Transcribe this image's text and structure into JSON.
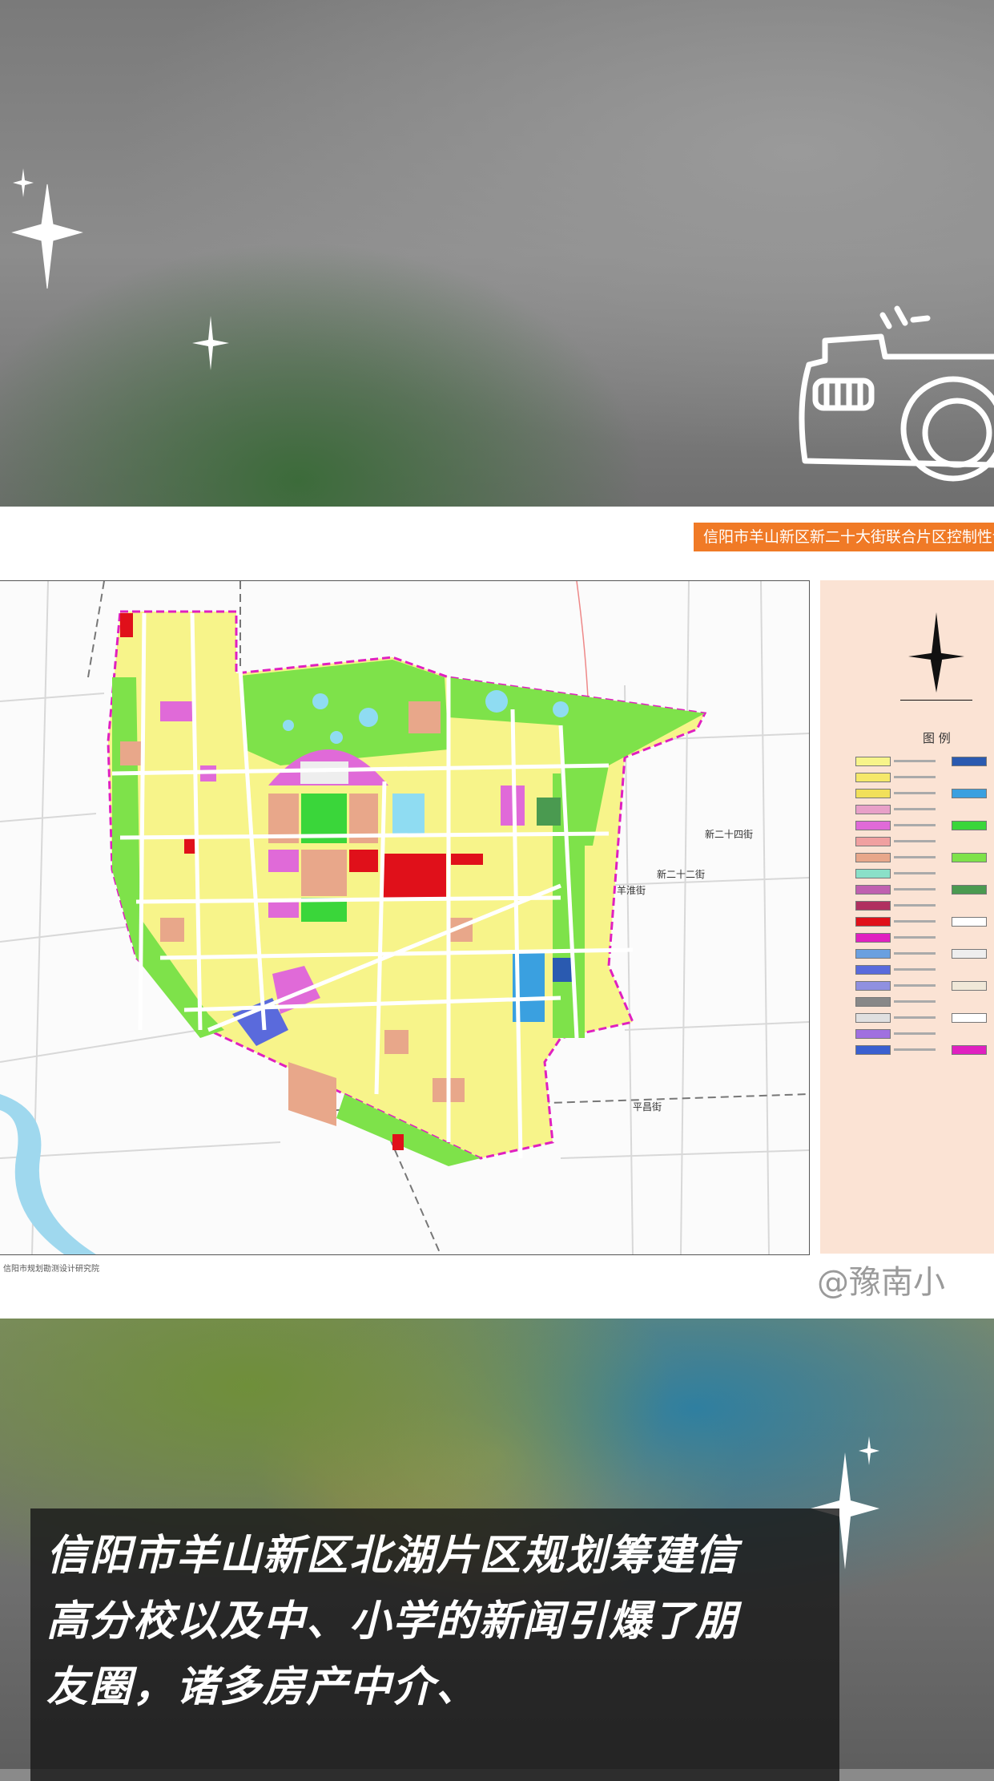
{
  "map": {
    "header_title": "信阳市羊山新区新二十大街联合片区控制性详细规划",
    "legend_title": "图 例",
    "street_labels": [
      "羊淮街",
      "新二十二街",
      "新二十四街",
      "平昌街"
    ],
    "institute": "信阳市规划勘测设计研究院",
    "watermark": "@豫南小"
  },
  "caption": {
    "text": "信阳市羊山新区北湖片区规划筹建信高分校以及中、小学的新闻引爆了朋友圈，诸多房产中介、"
  },
  "icons": [
    "sparkle-icon",
    "camera-icon",
    "north-arrow-icon"
  ],
  "colors": {
    "header": "#f07a26",
    "residential": "#f7f48a",
    "green": "#7ee24a",
    "commercial": "#e0101a",
    "education": "#e06ad8",
    "water": "#8fdcf2",
    "boundary": "#e020c0"
  }
}
